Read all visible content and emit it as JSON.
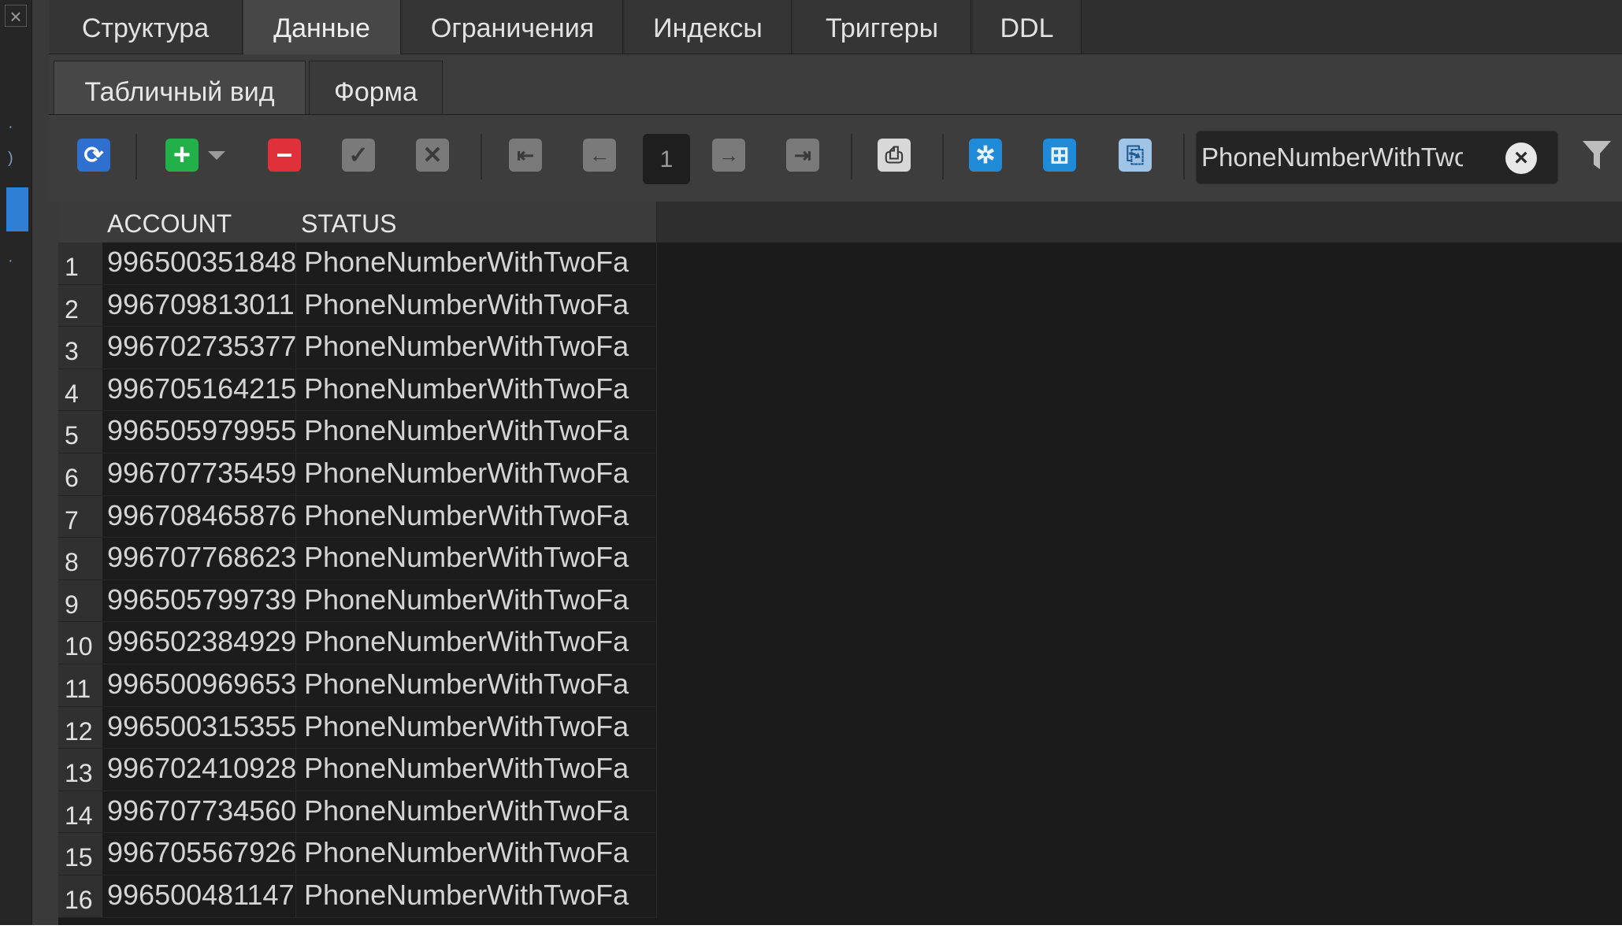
{
  "main_tabs": [
    {
      "label": "Структура"
    },
    {
      "label": "Данные"
    },
    {
      "label": "Ограничения"
    },
    {
      "label": "Индексы"
    },
    {
      "label": "Триггеры"
    },
    {
      "label": "DDL"
    }
  ],
  "sub_tabs": [
    {
      "label": "Табличный вид"
    },
    {
      "label": "Форма"
    }
  ],
  "toolbar": {
    "page_number": "1",
    "filter_value": "PhoneNumberWithTwoFa",
    "icons": [
      "refresh-icon",
      "add-icon",
      "dropdown-arrow-icon",
      "delete-icon",
      "apply-icon",
      "cancel-icon",
      "first-page-icon",
      "prev-page-icon",
      "next-page-icon",
      "last-page-icon",
      "print-icon",
      "expand-icon",
      "fit-icon",
      "export-icon",
      "clear-icon",
      "filter-icon",
      "filter-dropdown-icon"
    ]
  },
  "grid": {
    "columns": [
      "ACCOUNT",
      "STATUS"
    ],
    "rows": [
      {
        "n": "1",
        "account": "996500351848",
        "status": "PhoneNumberWithTwoFa"
      },
      {
        "n": "2",
        "account": "996709813011",
        "status": "PhoneNumberWithTwoFa"
      },
      {
        "n": "3",
        "account": "996702735377",
        "status": "PhoneNumberWithTwoFa"
      },
      {
        "n": "4",
        "account": "996705164215",
        "status": "PhoneNumberWithTwoFa"
      },
      {
        "n": "5",
        "account": "996505979955",
        "status": "PhoneNumberWithTwoFa"
      },
      {
        "n": "6",
        "account": "996707735459",
        "status": "PhoneNumberWithTwoFa"
      },
      {
        "n": "7",
        "account": "996708465876",
        "status": "PhoneNumberWithTwoFa"
      },
      {
        "n": "8",
        "account": "996707768623",
        "status": "PhoneNumberWithTwoFa"
      },
      {
        "n": "9",
        "account": "996505799739",
        "status": "PhoneNumberWithTwoFa"
      },
      {
        "n": "10",
        "account": "996502384929",
        "status": "PhoneNumberWithTwoFa"
      },
      {
        "n": "11",
        "account": "996500969653",
        "status": "PhoneNumberWithTwoFa"
      },
      {
        "n": "12",
        "account": "996500315355",
        "status": "PhoneNumberWithTwoFa"
      },
      {
        "n": "13",
        "account": "996702410928",
        "status": "PhoneNumberWithTwoFa"
      },
      {
        "n": "14",
        "account": "996707734560",
        "status": "PhoneNumberWithTwoFa"
      },
      {
        "n": "15",
        "account": "996705567926",
        "status": "PhoneNumberWithTwoFa"
      },
      {
        "n": "16",
        "account": "996500481147",
        "status": "PhoneNumberWithTwoFa"
      }
    ]
  },
  "colors": {
    "accent_blue": "#2f7fd6",
    "add_green": "#22b04a",
    "delete_red": "#e0303a",
    "background": "#3a3a3a",
    "grid_background": "#1b1b1b"
  }
}
